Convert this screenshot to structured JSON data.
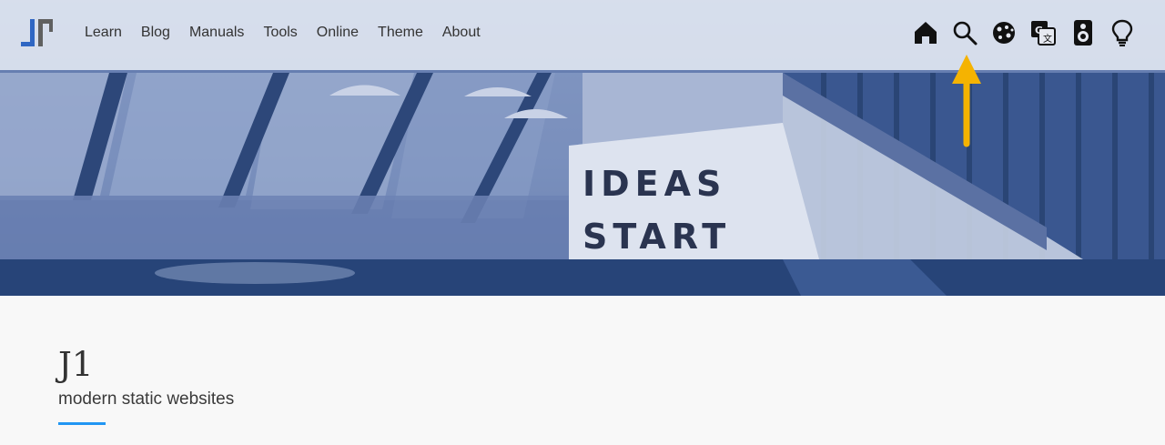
{
  "navbar": {
    "logo": "j1-logo-icon",
    "links": [
      {
        "label": "Learn"
      },
      {
        "label": "Blog"
      },
      {
        "label": "Manuals"
      },
      {
        "label": "Tools"
      },
      {
        "label": "Online"
      },
      {
        "label": "Theme"
      },
      {
        "label": "About"
      }
    ],
    "icons": [
      "home-icon",
      "search-icon",
      "cookie-icon",
      "translate-icon",
      "speaker-icon",
      "lightbulb-icon"
    ]
  },
  "hero": {
    "sign_line_1": "IDEAS",
    "sign_line_2": "START",
    "tint_color": "#3a5a94"
  },
  "annotation": {
    "arrow_color": "#f5b301",
    "points_to": "search-icon"
  },
  "intro": {
    "title": "J1",
    "subtitle": "modern static websites",
    "accent_color": "#2196f3"
  }
}
